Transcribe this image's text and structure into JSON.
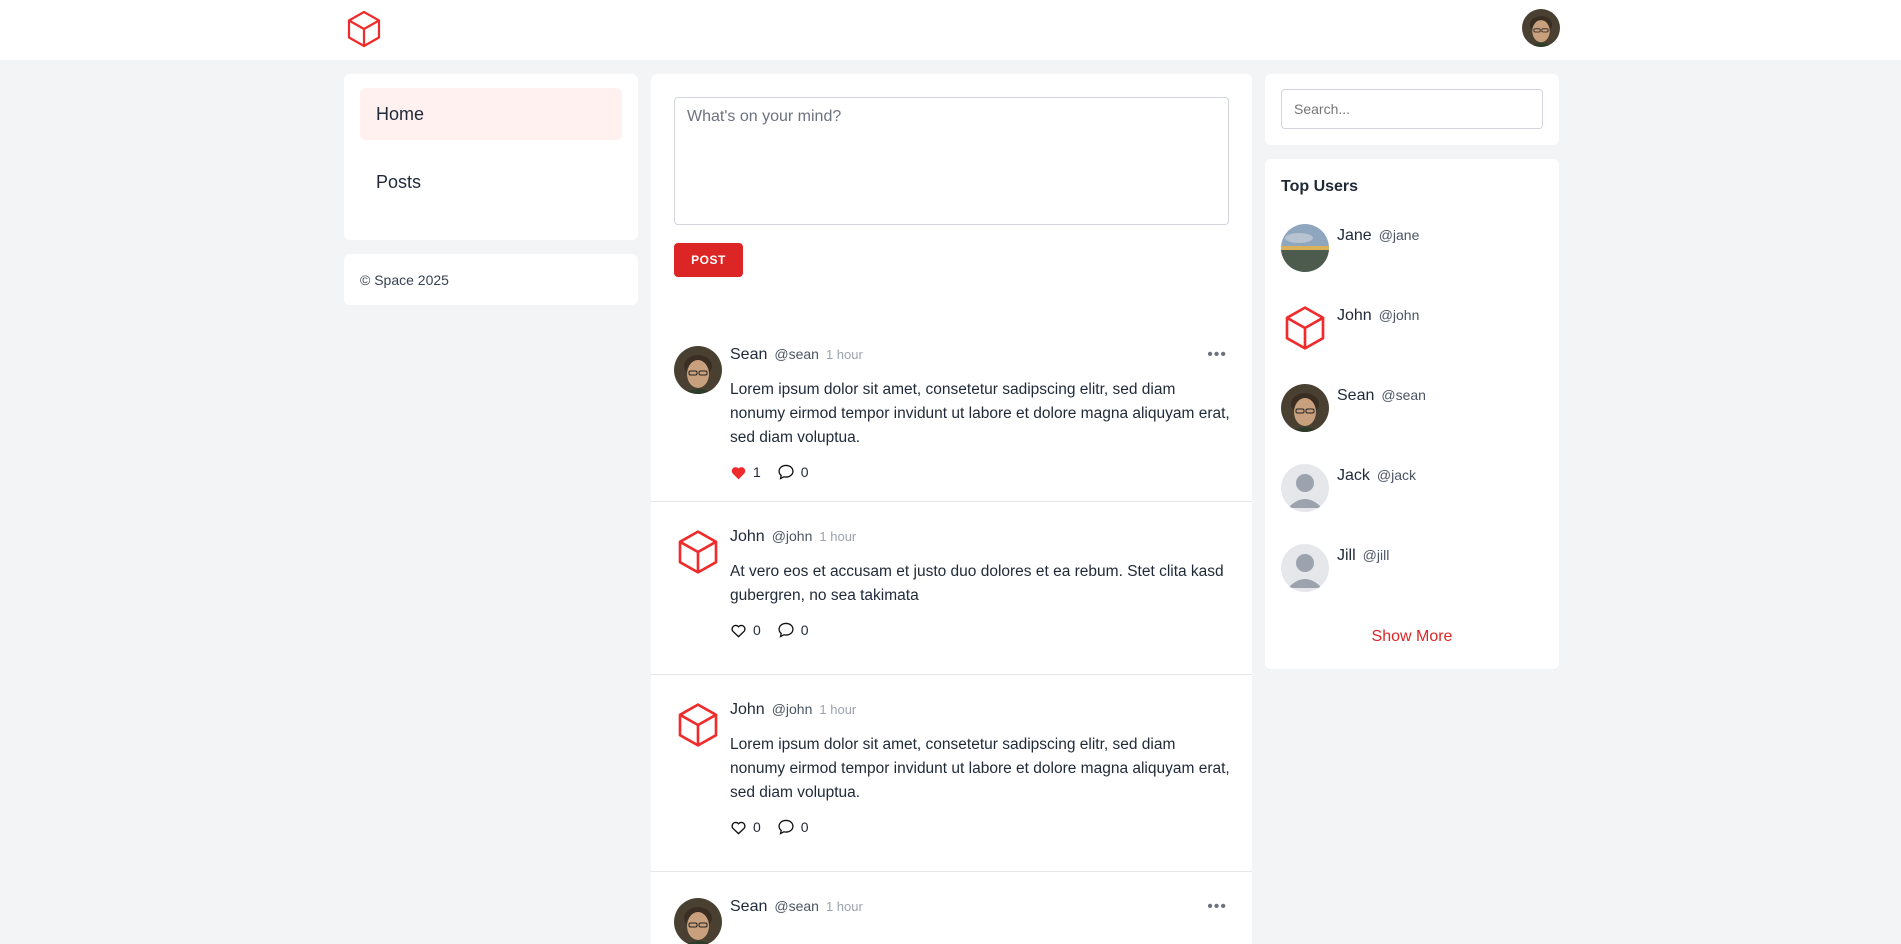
{
  "app": {
    "brand_color": "#dc2626"
  },
  "nav": {
    "items": [
      {
        "label": "Home",
        "active": true
      },
      {
        "label": "Posts",
        "active": false
      }
    ]
  },
  "footer": {
    "text": "© Space 2025"
  },
  "composer": {
    "placeholder": "What's on your mind?",
    "post_label": "POST"
  },
  "posts": [
    {
      "name": "Sean",
      "handle": "@sean",
      "time": "1 hour",
      "body": "Lorem ipsum dolor sit amet, consetetur sadipscing elitr, sed diam nonumy eirmod tempor invidunt ut labore et dolore magna aliquyam erat, sed diam voluptua.",
      "likes": "1",
      "comments": "0",
      "liked": true,
      "avatar": "photo"
    },
    {
      "name": "John",
      "handle": "@john",
      "time": "1 hour",
      "body": "At vero eos et accusam et justo duo dolores et ea rebum. Stet clita kasd gubergren, no sea takimata",
      "likes": "0",
      "comments": "0",
      "liked": false,
      "avatar": "cube-icon"
    },
    {
      "name": "John",
      "handle": "@john",
      "time": "1 hour",
      "body": "Lorem ipsum dolor sit amet, consetetur sadipscing elitr, sed diam nonumy eirmod tempor invidunt ut labore et dolore magna aliquyam erat, sed diam voluptua.",
      "likes": "0",
      "comments": "0",
      "liked": false,
      "avatar": "cube-icon"
    },
    {
      "name": "Sean",
      "handle": "@sean",
      "time": "1 hour"
    }
  ],
  "sidebar": {
    "search_placeholder": "Search...",
    "top_users_title": "Top Users",
    "users": [
      {
        "name": "Jane",
        "handle": "@jane"
      },
      {
        "name": "John",
        "handle": "@john"
      },
      {
        "name": "Sean",
        "handle": "@sean"
      },
      {
        "name": "Jack",
        "handle": "@jack"
      },
      {
        "name": "Jill",
        "handle": "@jill"
      }
    ],
    "show_more": "Show More"
  }
}
